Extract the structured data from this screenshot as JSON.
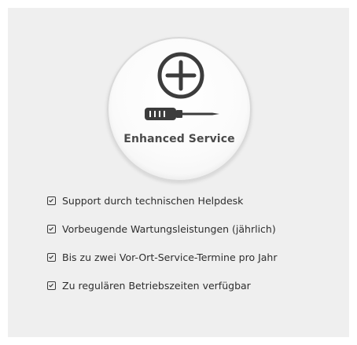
{
  "service": {
    "title": "Enhanced Service",
    "icon": "screwdriver-icon",
    "features": [
      "Support durch technischen Helpdesk",
      "Vorbeugende Wartungsleistungen (jährlich)",
      "Bis zu zwei Vor-Ort-Service-Termine pro Jahr",
      "Zu regulären Betriebszeiten verfügbar"
    ]
  },
  "colors": {
    "panel": "#efefef",
    "icon": "#3c3c3c",
    "text": "#2e2e2e"
  }
}
